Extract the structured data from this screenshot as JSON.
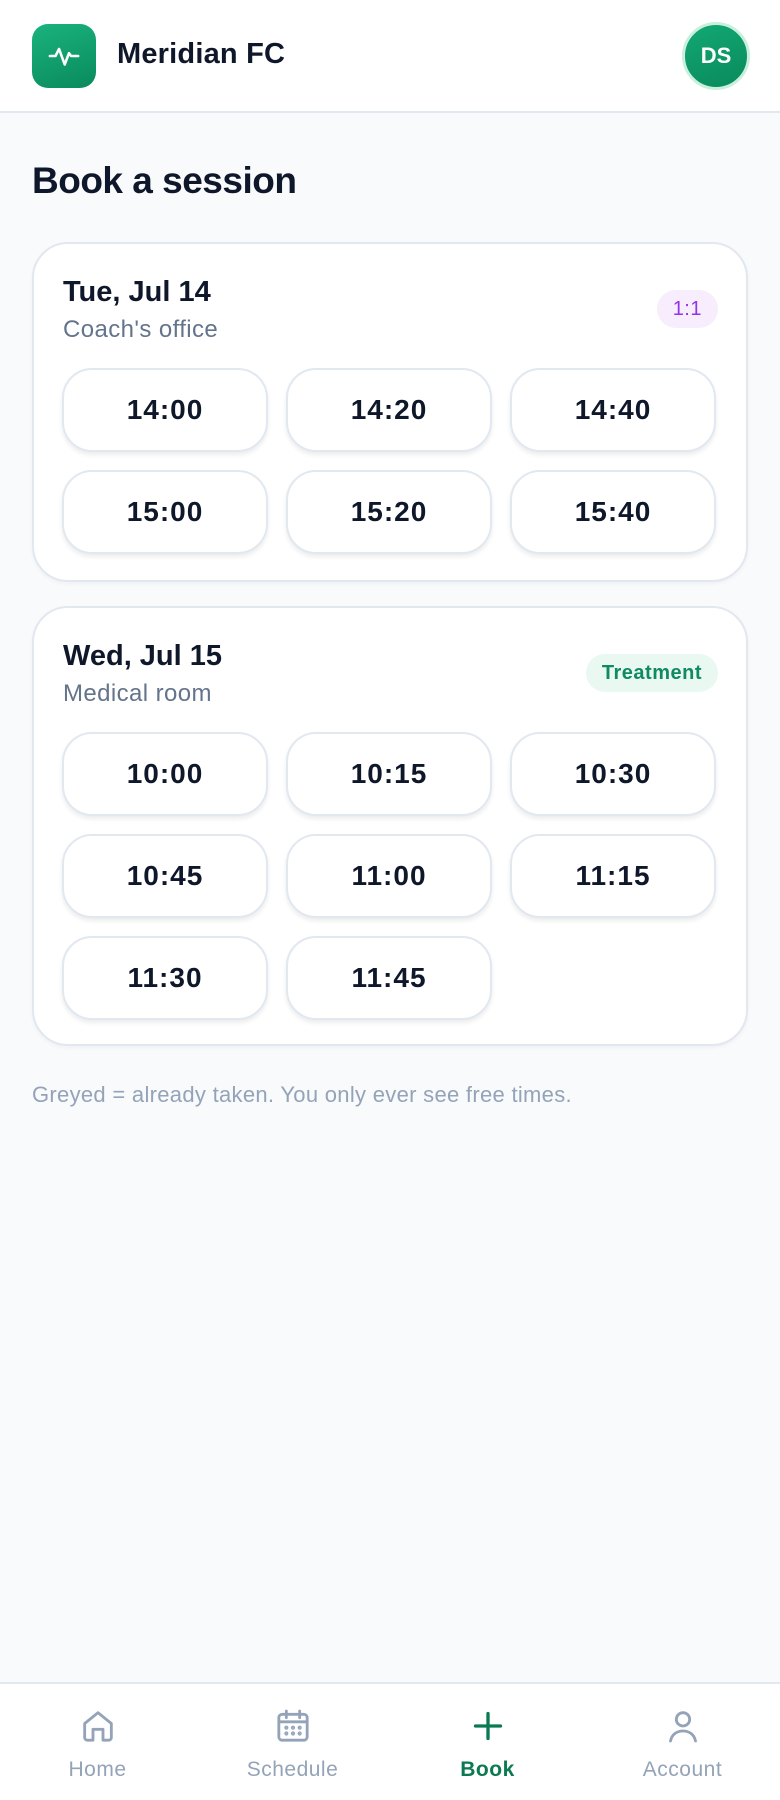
{
  "header": {
    "app_name": "Meridian FC",
    "logo_icon": "pulse-icon",
    "avatar_initials": "DS",
    "brand_color": "#0f9a6a"
  },
  "page": {
    "title": "Book a session"
  },
  "days": [
    {
      "date": "Tue, Jul 14",
      "location": "Coach's office",
      "badge": "1:1",
      "badge_color": "#9333ea",
      "slots": [
        "14:00",
        "14:20",
        "14:40",
        "15:00",
        "15:20",
        "15:40"
      ]
    },
    {
      "date": "Wed, Jul 15",
      "location": "Medical room",
      "badge": "Treatment",
      "badge_color": "#0f8a62",
      "slots": [
        "10:00",
        "10:15",
        "10:30",
        "10:45",
        "11:00",
        "11:15",
        "11:30",
        "11:45"
      ]
    }
  ],
  "footnote": "Greyed = already taken. You only ever see free times.",
  "nav": {
    "items": [
      {
        "label": "Home",
        "icon": "home-icon"
      },
      {
        "label": "Schedule",
        "icon": "calendar-icon"
      },
      {
        "label": "Book",
        "icon": "plus-icon",
        "active": true
      },
      {
        "label": "Account",
        "icon": "user-icon"
      }
    ],
    "active_color": "#0b7a52"
  }
}
